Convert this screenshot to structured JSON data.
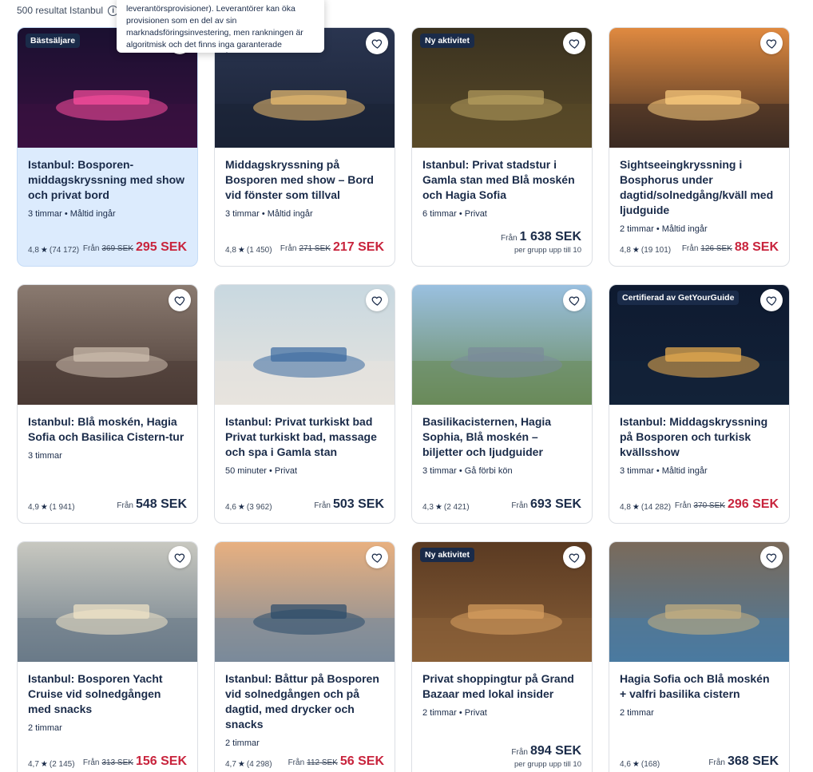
{
  "header": {
    "result_count": "500 resultat Istanbul",
    "tooltip_text": "leverantörsprovisioner). Leverantörer kan öka provisionen som en del av sin marknadsföringsinvestering, men rankningen är algoritmisk och det finns inga garanterade positioner. Nya aktiviteter får en fördel den första veckan, vilket gör det möjligt för oss att samla in data och ge dem en rättvis chans att konkurrera och få regelbundna bokningar."
  },
  "cards": [
    {
      "badge": "Bästsäljare",
      "title": "Istanbul: Bosporen-middagskryssning med show och privat bord",
      "meta": "3 timmar • Måltid ingår",
      "rating": "4,8",
      "reviews": "(74 172)",
      "from": "Från",
      "old_price": "369 SEK",
      "price": "295 SEK",
      "per": "",
      "highlight": true
    },
    {
      "badge": "",
      "title": "Middagskryssning på Bosporen med show – Bord vid fönster som tillval",
      "meta": "3 timmar • Måltid ingår",
      "rating": "4,8",
      "reviews": "(1 450)",
      "from": "Från",
      "old_price": "271 SEK",
      "price": "217 SEK",
      "per": ""
    },
    {
      "badge": "Ny aktivitet",
      "title": "Istanbul: Privat stadstur i Gamla stan med Blå moskén och Hagia Sofia",
      "meta": "6 timmar • Privat",
      "rating": "",
      "reviews": "",
      "from": "Från",
      "old_price": "",
      "price": "1 638 SEK",
      "per": "per grupp upp till 10"
    },
    {
      "badge": "",
      "title": "Sightseeingkryssning i Bosphorus under dagtid/solnedgång/kväll med ljudguide",
      "meta": "2 timmar • Måltid ingår",
      "rating": "4,8",
      "reviews": "(19 101)",
      "from": "Från",
      "old_price": "126 SEK",
      "price": "88 SEK",
      "per": ""
    },
    {
      "badge": "",
      "title": "Istanbul: Blå moskén, Hagia Sofia och Basilica Cistern-tur",
      "meta": "3 timmar",
      "rating": "4,9",
      "reviews": "(1 941)",
      "from": "Från",
      "old_price": "",
      "price": "548 SEK",
      "per": ""
    },
    {
      "badge": "",
      "title": "Istanbul: Privat turkiskt bad Privat turkiskt bad, massage och spa i Gamla stan",
      "meta": "50 minuter • Privat",
      "rating": "4,6",
      "reviews": "(3 962)",
      "from": "Från",
      "old_price": "",
      "price": "503 SEK",
      "per": ""
    },
    {
      "badge": "",
      "title": "Basilikacisternen, Hagia Sophia, Blå moskén – biljetter och ljudguider",
      "meta": "3 timmar • Gå förbi kön",
      "rating": "4,3",
      "reviews": "(2 421)",
      "from": "Från",
      "old_price": "",
      "price": "693 SEK",
      "per": ""
    },
    {
      "badge": "Certifierad av GetYourGuide",
      "title": "Istanbul: Middagskryssning på Bosporen och turkisk kvällsshow",
      "meta": "3 timmar • Måltid ingår",
      "rating": "4,8",
      "reviews": "(14 282)",
      "from": "Från",
      "old_price": "370 SEK",
      "price": "296 SEK",
      "per": ""
    },
    {
      "badge": "",
      "title": "Istanbul: Bosporen Yacht Cruise vid solnedgången med snacks",
      "meta": "2 timmar",
      "rating": "4,7",
      "reviews": "(2 145)",
      "from": "Från",
      "old_price": "313 SEK",
      "price": "156 SEK",
      "per": ""
    },
    {
      "badge": "",
      "title": "Istanbul: Båttur på Bosporen vid solnedgången och på dagtid, med drycker och snacks",
      "meta": "2 timmar",
      "rating": "4,7",
      "reviews": "(4 298)",
      "from": "Från",
      "old_price": "112 SEK",
      "price": "56 SEK",
      "per": ""
    },
    {
      "badge": "Ny aktivitet",
      "title": "Privat shoppingtur på Grand Bazaar med lokal insider",
      "meta": "2 timmar • Privat",
      "rating": "",
      "reviews": "",
      "from": "Från",
      "old_price": "",
      "price": "894 SEK",
      "per": "per grupp upp till 10"
    },
    {
      "badge": "",
      "title": "Hagia Sofia och Blå moskén + valfri basilika cistern",
      "meta": "2 timmar",
      "rating": "4,6",
      "reviews": "(168)",
      "from": "Från",
      "old_price": "",
      "price": "368 SEK",
      "per": ""
    }
  ],
  "images": [
    {
      "subject": "night-cruise-bridge-image",
      "sky": "#1a1030",
      "water": "#3a1040",
      "accent": "#ff4fa0"
    },
    {
      "subject": "dinner-cruise-boat-image",
      "sky": "#2a3550",
      "water": "#1a2235",
      "accent": "#f0c070"
    },
    {
      "subject": "medusa-head-cistern-image",
      "sky": "#3a3220",
      "water": "#5a4a28",
      "accent": "#b8a060"
    },
    {
      "subject": "sunset-ferry-image",
      "sky": "#e08a40",
      "water": "#3a2a22",
      "accent": "#ffd080"
    },
    {
      "subject": "mosque-visitors-image",
      "sky": "#8a7a70",
      "water": "#4a3a34",
      "accent": "#d0c0b0"
    },
    {
      "subject": "turkish-bath-image",
      "sky": "#c8d8e0",
      "water": "#e8e4de",
      "accent": "#3a6aa0"
    },
    {
      "subject": "blue-mosque-aerial-image",
      "sky": "#9ac0e0",
      "water": "#6a8a5a",
      "accent": "#7a8a9a"
    },
    {
      "subject": "lit-cruise-ship-image",
      "sky": "#0e1a30",
      "water": "#132238",
      "accent": "#f0b050"
    },
    {
      "subject": "yacht-sunset-bridge-image",
      "sky": "#c8c8c0",
      "water": "#6a7a88",
      "accent": "#f2e6c8"
    },
    {
      "subject": "yacht-harbor-image",
      "sky": "#e8b080",
      "water": "#7a8a9a",
      "accent": "#2a4a6a"
    },
    {
      "subject": "grand-bazaar-image",
      "sky": "#5a3a22",
      "water": "#8a6038",
      "accent": "#d8a060"
    },
    {
      "subject": "hagia-sofia-collage-image",
      "sky": "#7a6a5a",
      "water": "#4a7aa0",
      "accent": "#c8b080"
    }
  ]
}
